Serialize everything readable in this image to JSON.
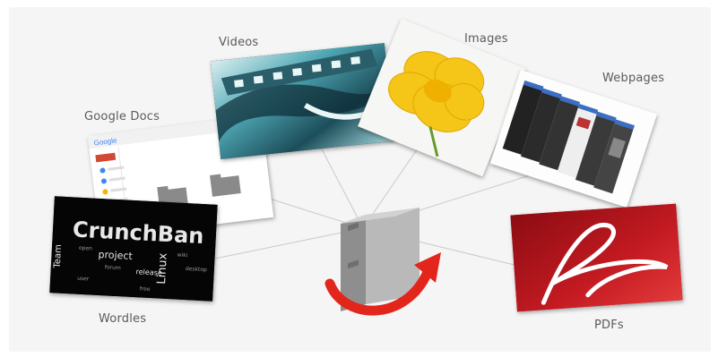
{
  "labels": {
    "videos": "Videos",
    "images": "Images",
    "webpages": "Webpages",
    "google_docs": "Google Docs",
    "wordles": "Wordles",
    "pdfs": "PDFs"
  },
  "wordle_words": {
    "crunchbang": "CrunchBan",
    "linux": "Linux",
    "project": "project",
    "team": "Team",
    "release": "release"
  },
  "colors": {
    "panel": "#f5f5f5",
    "label": "#5b5b5b",
    "binder": "#a9a9a9",
    "arrow": "#e3261b",
    "pdf_red": "#b5121b",
    "lines": "#c9c9c9"
  },
  "icons": {
    "center": "binder-with-arrow-icon",
    "pdf": "adobe-acrobat-logo"
  }
}
